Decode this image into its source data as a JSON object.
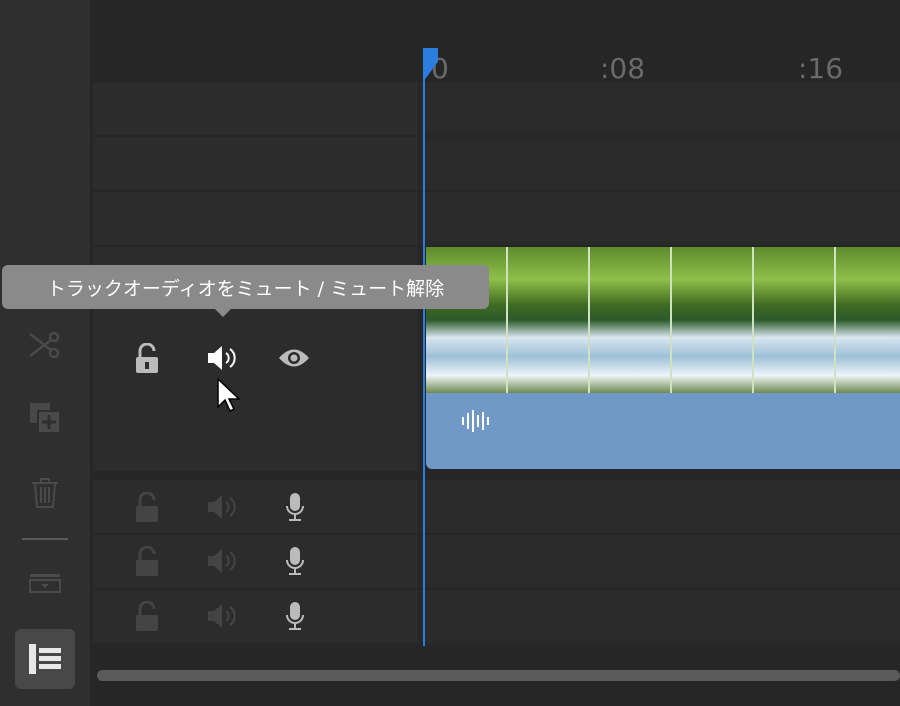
{
  "ruler": {
    "labels": [
      "0",
      ":08",
      ":16"
    ]
  },
  "tooltip": {
    "text": "トラックオーディオをミュート / ミュート解除"
  },
  "sidebar": {
    "icons": [
      "scissors-icon",
      "duplicate-icon",
      "trash-icon",
      "track-collapse-icon",
      "track-list-icon"
    ]
  },
  "tracks": {
    "video_track": {
      "icons": [
        "unlock-icon",
        "speaker-icon",
        "eye-icon"
      ]
    },
    "audio_tracks": [
      {
        "icons": [
          "unlock-icon",
          "speaker-icon",
          "microphone-icon"
        ]
      },
      {
        "icons": [
          "unlock-icon",
          "speaker-icon",
          "microphone-icon"
        ]
      },
      {
        "icons": [
          "unlock-icon",
          "speaker-icon",
          "microphone-icon"
        ]
      }
    ]
  },
  "colors": {
    "playhead": "#2b7de0",
    "audio_clip": "#7199c8"
  }
}
